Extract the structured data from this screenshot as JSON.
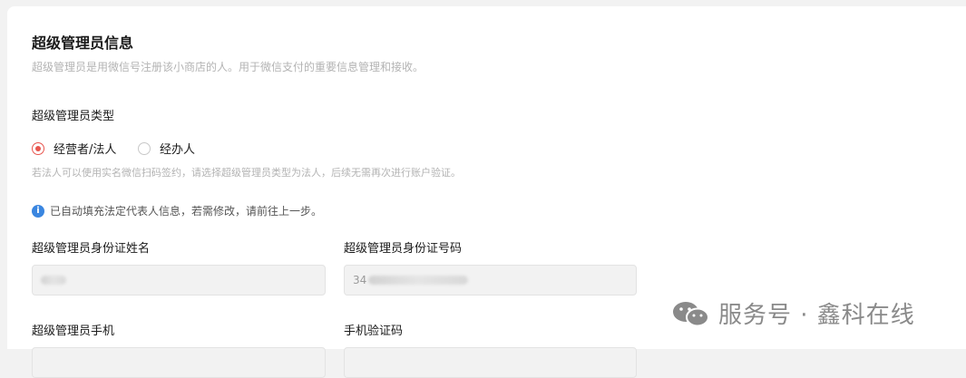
{
  "section": {
    "title": "超级管理员信息",
    "description": "超级管理员是用微信号注册该小商店的人。用于微信支付的重要信息管理和接收。"
  },
  "admin_type": {
    "label": "超级管理员类型",
    "options": [
      {
        "label": "经营者/法人",
        "selected": true
      },
      {
        "label": "经办人",
        "selected": false
      }
    ],
    "hint": "若法人可以使用实名微信扫码签约，请选择超级管理员类型为法人，后续无需再次进行账户验证。"
  },
  "notice": {
    "icon": "info-icon",
    "text": "已自动填充法定代表人信息，若需修改，请前往上一步。"
  },
  "fields": {
    "name_label": "超级管理员身份证姓名",
    "name_value": "",
    "id_label": "超级管理员身份证号码",
    "id_value_prefix": "34",
    "phone_label": "超级管理员手机",
    "code_label": "手机验证码"
  },
  "watermark": {
    "text": "服务号 · 鑫科在线"
  },
  "colors": {
    "accent": "#e8554e",
    "info": "#3a86e0"
  }
}
